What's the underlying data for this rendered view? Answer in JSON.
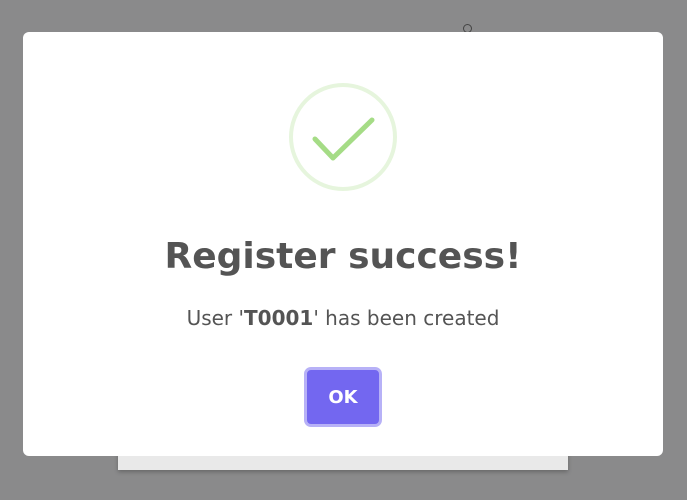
{
  "dialog": {
    "title": "Register success!",
    "message": {
      "prefix": "User '",
      "username": "T0001",
      "suffix": "' has been created"
    },
    "ok_label": "OK",
    "icon": "success-check-icon"
  },
  "colors": {
    "backdrop": "#8a8a8b",
    "accent": "#7367f0",
    "success": "#a5dc86",
    "text": "#545454"
  }
}
